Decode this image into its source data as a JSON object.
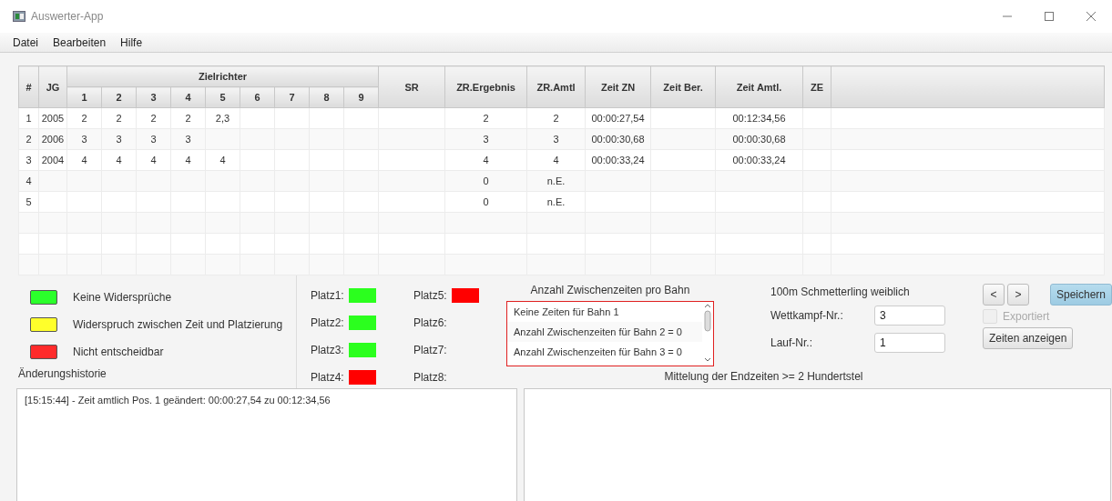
{
  "window": {
    "title": "Auswerter-App"
  },
  "menu": [
    "Datei",
    "Bearbeiten",
    "Hilfe"
  ],
  "table": {
    "columns": {
      "number": "#",
      "jg": "JG",
      "judges_group": "Zielrichter",
      "judges": [
        "1",
        "2",
        "3",
        "4",
        "5",
        "6",
        "7",
        "8",
        "9"
      ],
      "sr": "SR",
      "zr_ergebnis": "ZR.Ergebnis",
      "zr_amtl": "ZR.Amtl",
      "zeit_zn": "Zeit ZN",
      "zeit_ber": "Zeit Ber.",
      "zeit_amtl": "Zeit Amtl.",
      "ze": "ZE"
    },
    "rows": [
      {
        "number": "1",
        "jg": "2005",
        "judges": [
          "2",
          "2",
          "2",
          "2",
          "2,3"
        ],
        "zr_ergebnis": "2",
        "zr_amtl": "2",
        "zeit_zn": "00:00:27,54",
        "zeit_amtl": "00:12:34,56"
      },
      {
        "number": "2",
        "jg": "2006",
        "judges": [
          "3",
          "3",
          "3",
          "3"
        ],
        "zr_ergebnis": "3",
        "zr_amtl": "3",
        "zeit_zn": "00:00:30,68",
        "zeit_amtl": "00:00:30,68"
      },
      {
        "number": "3",
        "jg": "2004",
        "judges": [
          "4",
          "4",
          "4",
          "4",
          "4"
        ],
        "zr_ergebnis": "4",
        "zr_amtl": "4",
        "zeit_zn": "00:00:33,24",
        "zeit_amtl": "00:00:33,24"
      },
      {
        "number": "4",
        "zr_ergebnis": "0",
        "zr_amtl": "n.E."
      },
      {
        "number": "5",
        "zr_ergebnis": "0",
        "zr_amtl": "n.E."
      }
    ]
  },
  "legend": [
    {
      "label": "Keine Widersprüche",
      "color": "#2bff2b"
    },
    {
      "label": "Widerspruch zwischen Zeit und Platzierung",
      "color": "#ffff2b"
    },
    {
      "label": "Nicht entscheidbar",
      "color": "#ff2b2b"
    }
  ],
  "history_label": "Änderungshistorie",
  "places": [
    {
      "label": "Platz1:",
      "color": "#2bff1e"
    },
    {
      "label": "Platz2:",
      "color": "#2bff1e"
    },
    {
      "label": "Platz3:",
      "color": "#2bff1e"
    },
    {
      "label": "Platz4:",
      "color": "#ff0000"
    },
    {
      "label": "Platz5:",
      "color": "#ff0000"
    },
    {
      "label": "Platz6:"
    },
    {
      "label": "Platz7:"
    },
    {
      "label": "Platz8:"
    }
  ],
  "split_times": {
    "title": "Anzahl Zwischenzeiten pro Bahn",
    "items": [
      "Keine Zeiten für Bahn 1",
      "Anzahl Zwischenzeiten für Bahn 2 = 0",
      "Anzahl Zwischenzeiten für Bahn 3 = 0"
    ]
  },
  "event": {
    "title": "100m Schmetterling weiblich",
    "fields": [
      {
        "label": "Wettkampf-Nr.:",
        "value": "3"
      },
      {
        "label": "Lauf-Nr.:",
        "value": "1"
      }
    ]
  },
  "nav_buttons": [
    "<",
    ">"
  ],
  "save_button": "Speichern",
  "exported": {
    "label": "Exportiert",
    "checked": false,
    "disabled": true
  },
  "show_times_button": "Zeiten anzeigen",
  "hint": "Mittelung der Endzeiten >= 2 Hundertstel",
  "history_log": "[15:15:44] - Zeit amtlich Pos. 1 geändert: 00:00:27,54 zu 00:12:34,56"
}
